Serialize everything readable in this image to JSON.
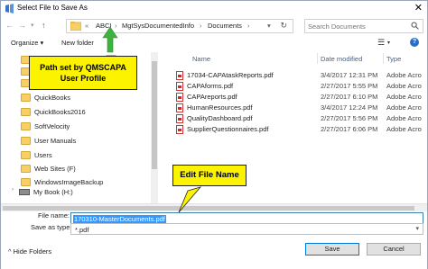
{
  "window": {
    "title": "Select File to Save As",
    "close_glyph": "✕"
  },
  "address": {
    "back_glyph": "←",
    "forward_glyph": "→",
    "up_glyph": "↑",
    "crumbs": [
      "«",
      "ABCI",
      "›",
      "MgtSysDocumentedInfo",
      "›",
      "Documents",
      "›"
    ],
    "search_placeholder": "Search Documents"
  },
  "toolbar": {
    "organize": "Organize ▾",
    "new_folder": "New folder",
    "view_glyph": "☰",
    "help_glyph": "?"
  },
  "nav": {
    "items": [
      {
        "label": ""
      },
      {
        "label": ""
      },
      {
        "label": ""
      },
      {
        "label": "QuickBooks"
      },
      {
        "label": "QuickBooks2016"
      },
      {
        "label": "SoftVelocity"
      },
      {
        "label": "User Manuals"
      },
      {
        "label": "Users"
      },
      {
        "label": "Web Sites (F)"
      },
      {
        "label": "WindowsImageBackup"
      }
    ],
    "drive": {
      "label": "My Book (H:)",
      "arrow": "›"
    }
  },
  "filelist": {
    "headers": {
      "name": "Name",
      "date": "Date modified",
      "type": "Type"
    },
    "files": [
      {
        "name": "17034-CAPAtaskReports.pdf",
        "date": "3/4/2017 12:31 PM",
        "type": "Adobe Acro"
      },
      {
        "name": "CAPAforms.pdf",
        "date": "2/27/2017 5:55 PM",
        "type": "Adobe Acro"
      },
      {
        "name": "CAPAreports.pdf",
        "date": "2/27/2017 6:10 PM",
        "type": "Adobe Acro"
      },
      {
        "name": "HumanResources.pdf",
        "date": "3/4/2017 12:24 PM",
        "type": "Adobe Acro"
      },
      {
        "name": "QualityDashboard.pdf",
        "date": "2/27/2017 5:56 PM",
        "type": "Adobe Acro"
      },
      {
        "name": "SupplierQuestionnaires.pdf",
        "date": "2/27/2017 6:06 PM",
        "type": "Adobe Acro"
      }
    ]
  },
  "form": {
    "file_name_label": "File name:",
    "file_name_value": "170310-MasterDocuments.pdf",
    "save_as_type_label": "Save as type:",
    "save_as_type_value": "*.pdf",
    "hide_folders": "Hide Folders",
    "hide_folders_glyph": "^",
    "save_button": "Save",
    "cancel_button": "Cancel"
  },
  "callouts": {
    "path": "Path set by QMSCAPA User Profile",
    "filename": "Edit File Name",
    "color": "#fbf300",
    "arrow_color": "#3db33d"
  }
}
